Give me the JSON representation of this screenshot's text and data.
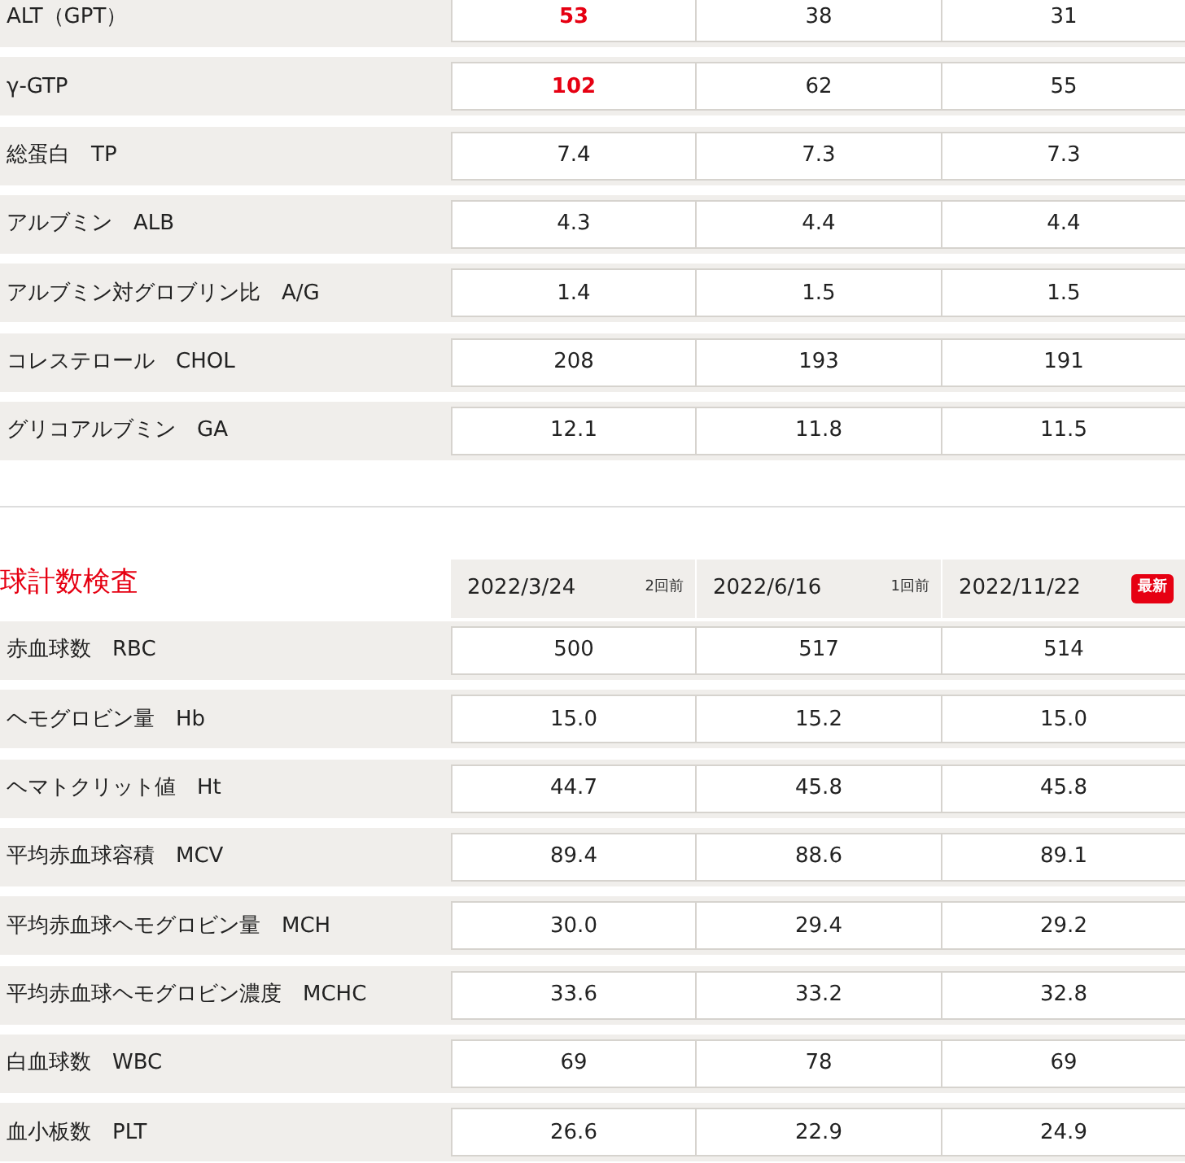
{
  "sections": [
    {
      "rows": [
        {
          "label": "ALT（GPT）",
          "values": [
            {
              "text": "53",
              "high": true
            },
            {
              "text": "38",
              "high": false
            },
            {
              "text": "31",
              "high": false
            }
          ]
        },
        {
          "label": "γ-GTP",
          "values": [
            {
              "text": "102",
              "high": true
            },
            {
              "text": "62",
              "high": false
            },
            {
              "text": "55",
              "high": false
            }
          ]
        },
        {
          "label": "総蛋白　TP",
          "values": [
            {
              "text": "7.4",
              "high": false
            },
            {
              "text": "7.3",
              "high": false
            },
            {
              "text": "7.3",
              "high": false
            }
          ]
        },
        {
          "label": "アルブミン　ALB",
          "values": [
            {
              "text": "4.3",
              "high": false
            },
            {
              "text": "4.4",
              "high": false
            },
            {
              "text": "4.4",
              "high": false
            }
          ]
        },
        {
          "label": "アルブミン対グロブリン比　A/G",
          "values": [
            {
              "text": "1.4",
              "high": false
            },
            {
              "text": "1.5",
              "high": false
            },
            {
              "text": "1.5",
              "high": false
            }
          ]
        },
        {
          "label": "コレステロール　CHOL",
          "values": [
            {
              "text": "208",
              "high": false
            },
            {
              "text": "193",
              "high": false
            },
            {
              "text": "191",
              "high": false
            }
          ]
        },
        {
          "label": "グリコアルブミン　GA",
          "values": [
            {
              "text": "12.1",
              "high": false
            },
            {
              "text": "11.8",
              "high": false
            },
            {
              "text": "11.5",
              "high": false
            }
          ]
        }
      ]
    },
    {
      "title": "球計数検査",
      "columns": [
        {
          "date": "2022/3/24",
          "tag": "2回前",
          "kind": "ago"
        },
        {
          "date": "2022/6/16",
          "tag": "1回前",
          "kind": "ago"
        },
        {
          "date": "2022/11/22",
          "tag": "最新",
          "kind": "latest"
        }
      ],
      "rows": [
        {
          "label": "赤血球数　RBC",
          "values": [
            {
              "text": "500",
              "high": false
            },
            {
              "text": "517",
              "high": false
            },
            {
              "text": "514",
              "high": false
            }
          ]
        },
        {
          "label": "ヘモグロビン量　Hb",
          "values": [
            {
              "text": "15.0",
              "high": false
            },
            {
              "text": "15.2",
              "high": false
            },
            {
              "text": "15.0",
              "high": false
            }
          ]
        },
        {
          "label": "ヘマトクリット値　Ht",
          "values": [
            {
              "text": "44.7",
              "high": false
            },
            {
              "text": "45.8",
              "high": false
            },
            {
              "text": "45.8",
              "high": false
            }
          ]
        },
        {
          "label": "平均赤血球容積　MCV",
          "values": [
            {
              "text": "89.4",
              "high": false
            },
            {
              "text": "88.6",
              "high": false
            },
            {
              "text": "89.1",
              "high": false
            }
          ]
        },
        {
          "label": "平均赤血球ヘモグロビン量　MCH",
          "values": [
            {
              "text": "30.0",
              "high": false
            },
            {
              "text": "29.4",
              "high": false
            },
            {
              "text": "29.2",
              "high": false
            }
          ]
        },
        {
          "label": "平均赤血球ヘモグロビン濃度　MCHC",
          "values": [
            {
              "text": "33.6",
              "high": false
            },
            {
              "text": "33.2",
              "high": false
            },
            {
              "text": "32.8",
              "high": false
            }
          ]
        },
        {
          "label": "白血球数　WBC",
          "values": [
            {
              "text": "69",
              "high": false
            },
            {
              "text": "78",
              "high": false
            },
            {
              "text": "69",
              "high": false
            }
          ]
        },
        {
          "label": "血小板数　PLT",
          "values": [
            {
              "text": "26.6",
              "high": false
            },
            {
              "text": "22.9",
              "high": false
            },
            {
              "text": "24.9",
              "high": false
            }
          ]
        }
      ]
    }
  ]
}
